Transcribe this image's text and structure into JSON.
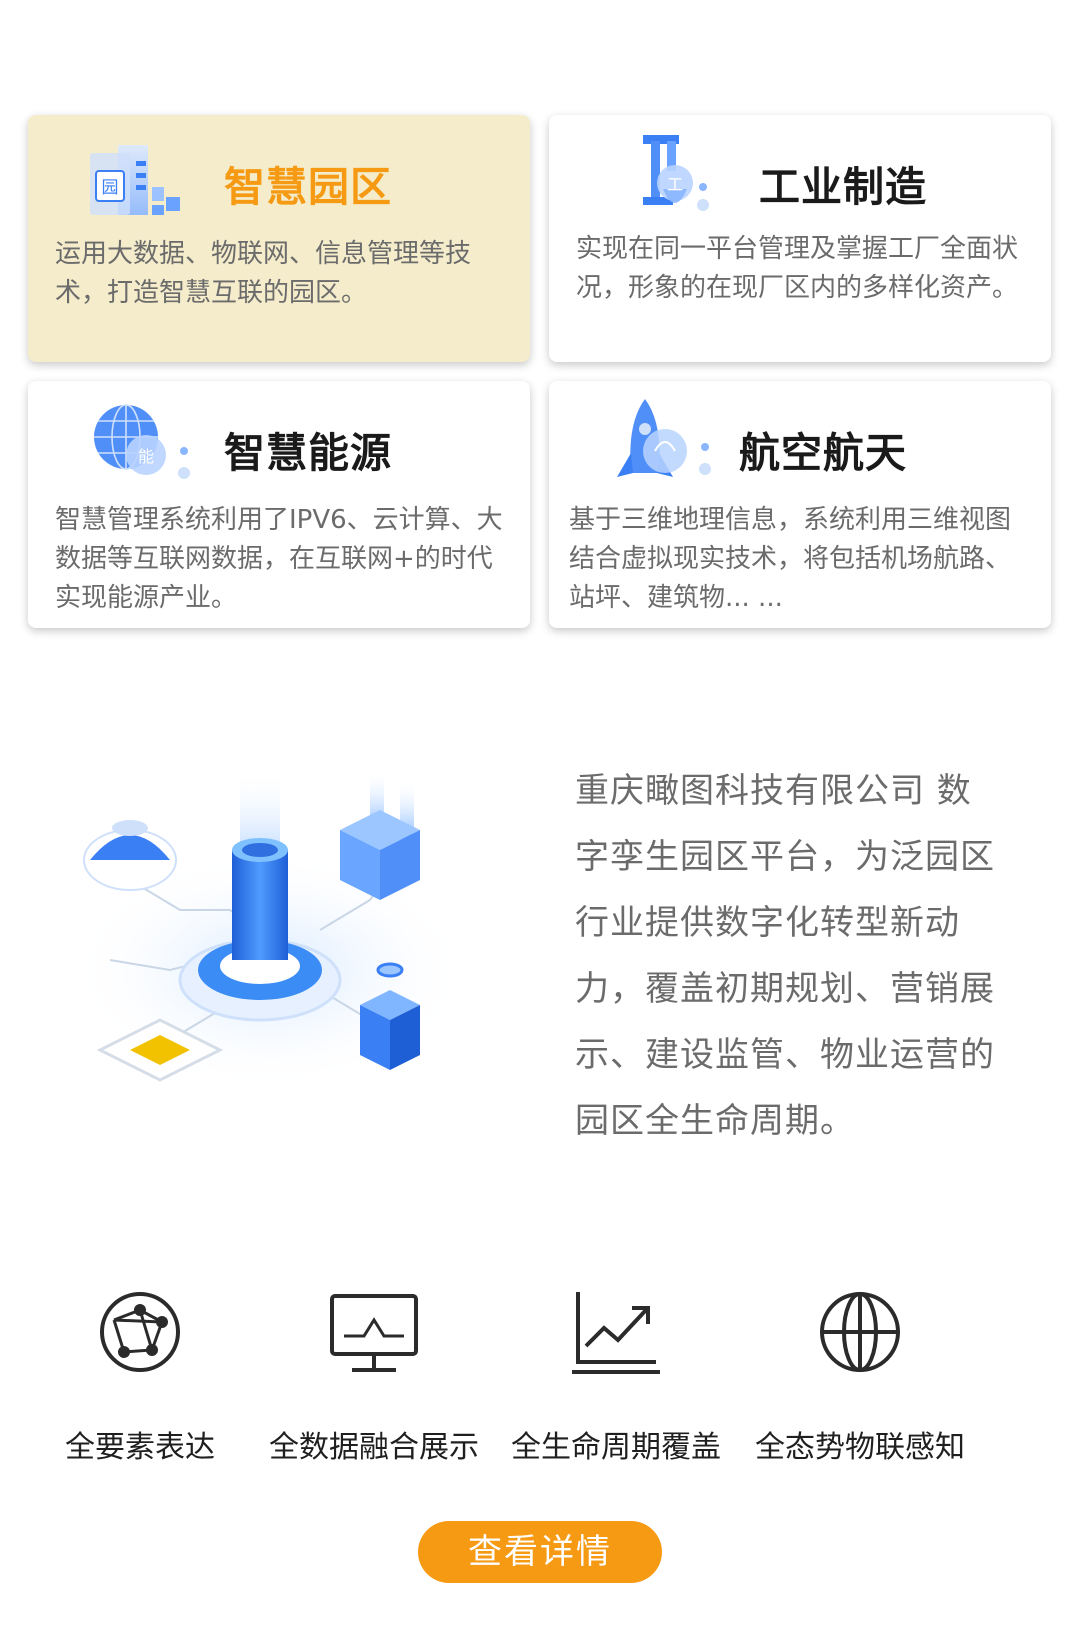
{
  "cards": [
    {
      "title": "智慧园区",
      "desc": "运用大数据、物联网、信息管理等技术，打造智慧互联的园区。",
      "icon": "park-building-icon",
      "icon_badge": "园"
    },
    {
      "title": "工业制造",
      "desc": "实现在同一平台管理及掌握工厂全面状况，形象的在现厂区内的多样化资产。",
      "icon": "industry-crane-icon",
      "icon_badge": "工"
    },
    {
      "title": "智慧能源",
      "desc": "智慧管理系统利用了IPV6、云计算、大数据等互联网数据，在互联网+的时代实现能源产业。",
      "icon": "energy-globe-icon",
      "icon_badge": "能"
    },
    {
      "title": "航空航天",
      "desc": "基于三维地理信息，系统利用三维视图结合虚拟现实技术，将包括机场航路、站坪、建筑物... ...",
      "icon": "aerospace-rocket-icon",
      "icon_badge": ""
    }
  ],
  "hero": {
    "text": "重庆瞰图科技有限公司  数字孪生园区平台，为泛园区行业提供数字化转型新动力，覆盖初期规划、营销展示、建设监管、物业运营的园区全生命周期。",
    "illustration": "digital-twin-isometric-illustration"
  },
  "features": [
    {
      "label": "全要素表达",
      "icon": "network-sphere-icon"
    },
    {
      "label": "全数据融合展示",
      "icon": "monitor-chart-icon"
    },
    {
      "label": "全生命周期覆盖",
      "icon": "trend-chart-icon"
    },
    {
      "label": "全态势物联感知",
      "icon": "globe-icon"
    }
  ],
  "cta_label": "查看详情",
  "colors": {
    "accent": "#f59a12",
    "active_card_bg": "#f4eccb",
    "text_gray": "#6b6b6b",
    "icon_blue": "#3b7ff5"
  }
}
